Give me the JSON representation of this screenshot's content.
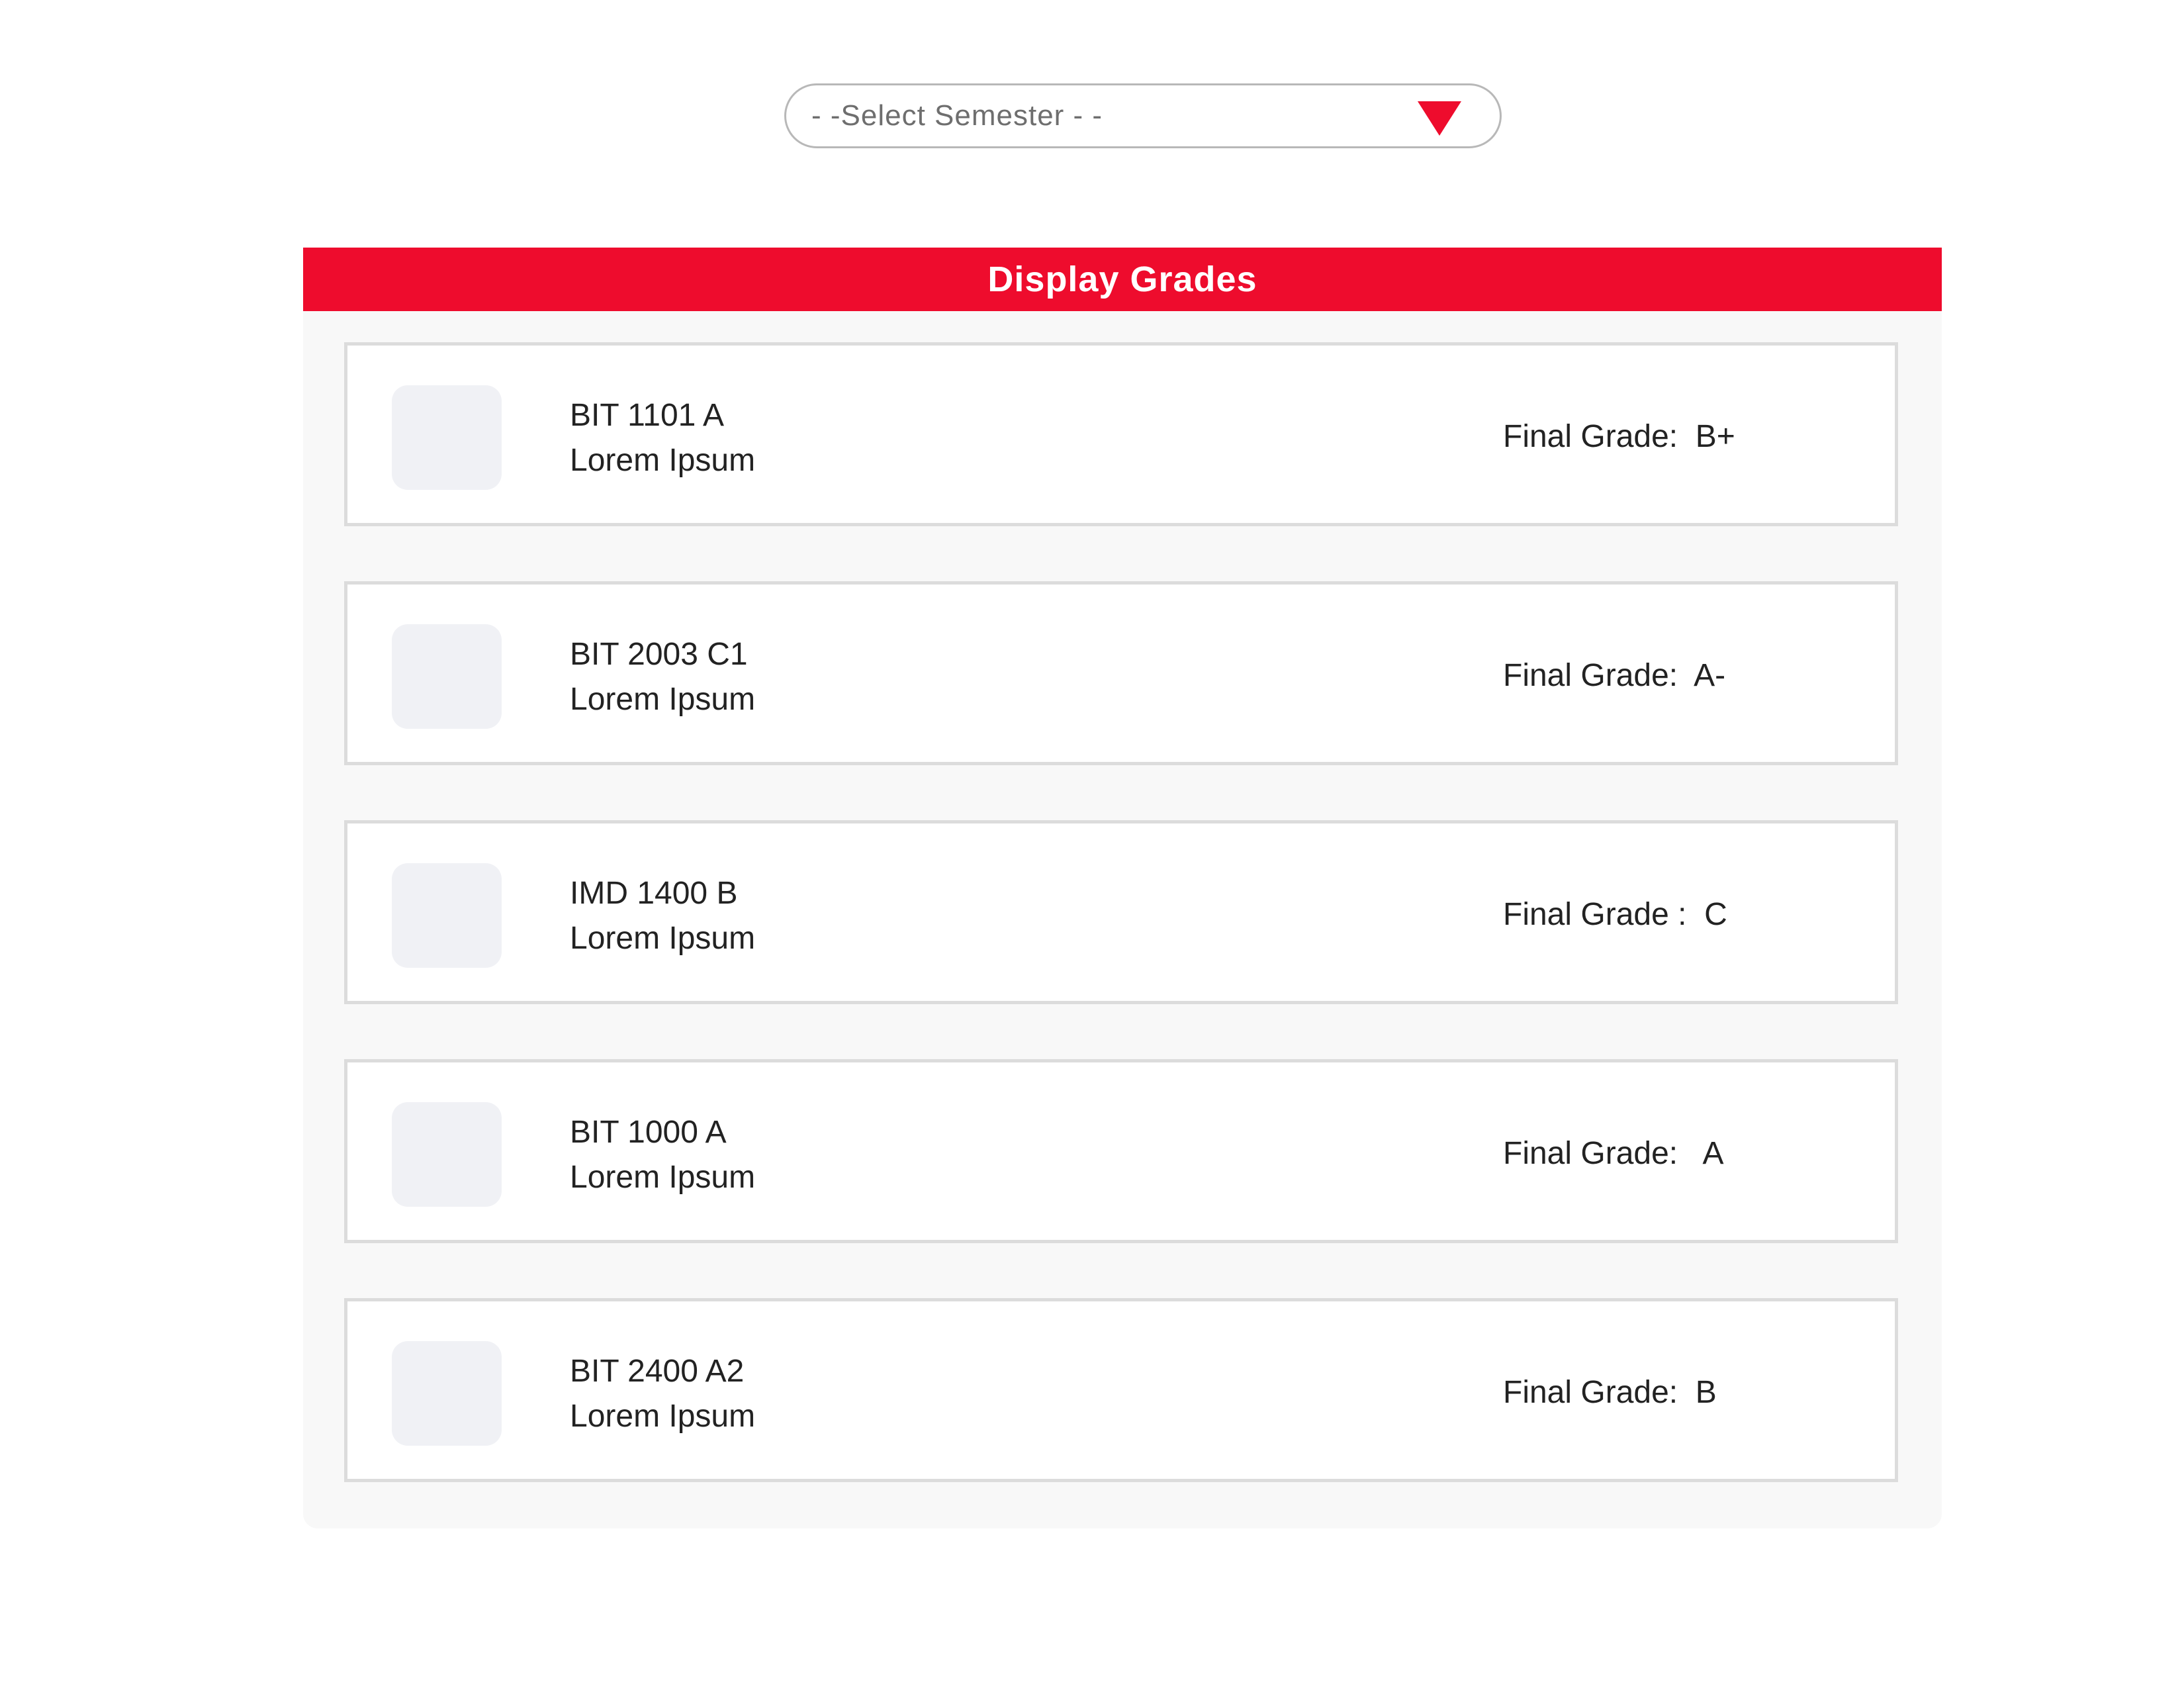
{
  "semester_select": {
    "placeholder": "- -Select Semester - -"
  },
  "panel": {
    "title": "Display Grades"
  },
  "courses": [
    {
      "code": "BIT 1101 A",
      "name": "Lorem Ipsum",
      "grade_text": "Final Grade:  B+"
    },
    {
      "code": "BIT 2003 C1",
      "name": "Lorem Ipsum",
      "grade_text": "Final Grade:  A-"
    },
    {
      "code": "IMD 1400 B",
      "name": "Lorem Ipsum",
      "grade_text": "Final Grade :  C"
    },
    {
      "code": "BIT 1000 A",
      "name": "Lorem Ipsum",
      "grade_text": "Final Grade:   A"
    },
    {
      "code": "BIT 2400 A2",
      "name": "Lorem Ipsum",
      "grade_text": "Final Grade:  B"
    }
  ],
  "colors": {
    "accent": "#ee0c2d",
    "panel_background": "#f8f8f8",
    "card_border": "#dcdcdc",
    "thumbnail": "#f0f1f5"
  },
  "icons": {
    "dropdown": "caret-down-icon"
  }
}
